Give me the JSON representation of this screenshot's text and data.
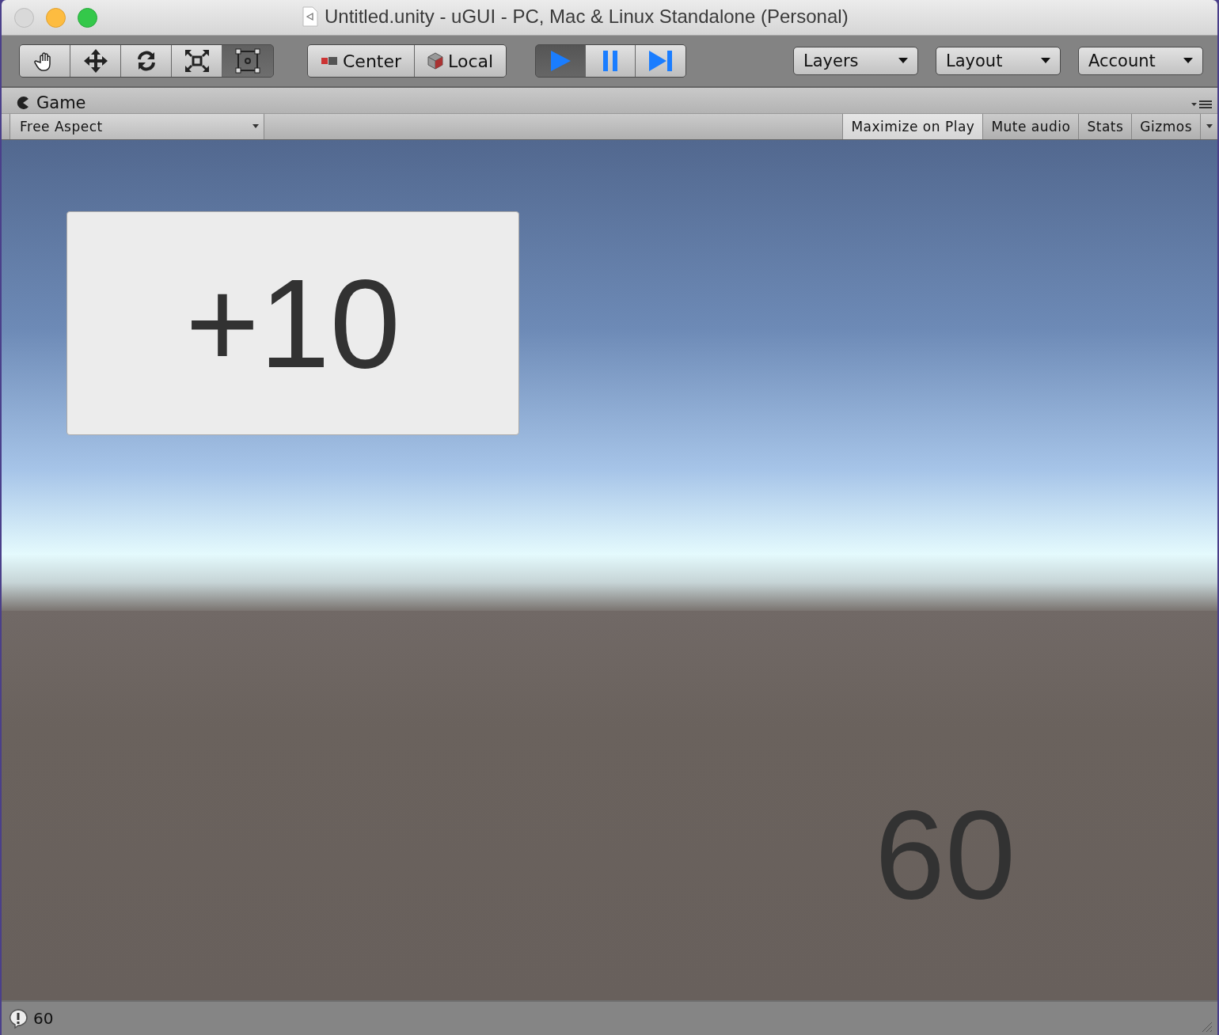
{
  "window": {
    "title": "Untitled.unity - uGUI - PC, Mac & Linux Standalone (Personal)"
  },
  "toolbar": {
    "tools": [
      {
        "kind": "hand",
        "selected": false
      },
      {
        "kind": "move",
        "selected": false
      },
      {
        "kind": "rotate",
        "selected": false
      },
      {
        "kind": "scale",
        "selected": false
      },
      {
        "kind": "rect",
        "selected": true
      }
    ],
    "pivot": [
      {
        "kind": "center",
        "label": "Center"
      },
      {
        "kind": "local",
        "label": "Local"
      }
    ],
    "playback": [
      {
        "kind": "play",
        "selected": true
      },
      {
        "kind": "pause",
        "selected": false
      },
      {
        "kind": "step",
        "selected": false
      }
    ],
    "dropdowns": [
      "Layers",
      "Layout",
      "Account"
    ]
  },
  "game_view": {
    "tab": "Game",
    "aspect": "Free Aspect",
    "toggles": [
      {
        "label": "Maximize on Play",
        "on": true
      },
      {
        "label": "Mute audio",
        "on": false
      },
      {
        "label": "Stats",
        "on": false
      },
      {
        "label": "Gizmos",
        "on": false
      }
    ]
  },
  "scene": {
    "button_label": "+10",
    "score": "60"
  },
  "status_bar": {
    "message": "60"
  }
}
